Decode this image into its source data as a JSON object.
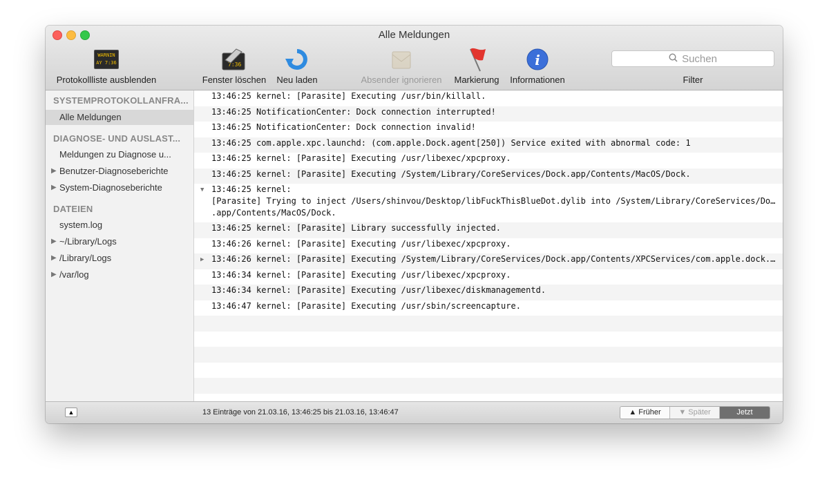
{
  "window": {
    "title": "Alle Meldungen"
  },
  "toolbar": {
    "hide_list_label": "Protokollliste ausblenden",
    "warn_icon_text": "WARNING\nAY 7:36",
    "clear_label": "Fenster löschen",
    "reload_label": "Neu laden",
    "ignore_sender_label": "Absender ignorieren",
    "mark_label": "Markierung",
    "info_label": "Informationen",
    "search_placeholder": "Suchen",
    "filter_label": "Filter"
  },
  "sidebar": {
    "section1": "SYSTEMPROTOKOLLANFRA...",
    "section1_items": [
      {
        "label": "Alle Meldungen"
      }
    ],
    "section2": "DIAGNOSE- UND AUSLAST...",
    "section2_items": [
      {
        "label": "Meldungen zu Diagnose u..."
      },
      {
        "label": "Benutzer-Diagnoseberichte"
      },
      {
        "label": "System-Diagnoseberichte"
      }
    ],
    "section3": "DATEIEN",
    "section3_items": [
      {
        "label": "system.log"
      },
      {
        "label": "~/Library/Logs"
      },
      {
        "label": "/Library/Logs"
      },
      {
        "label": "/var/log"
      }
    ]
  },
  "log": [
    {
      "text": "13:46:25 kernel: [Parasite] Executing /usr/bin/killall."
    },
    {
      "text": "13:46:25 NotificationCenter: Dock connection interrupted!"
    },
    {
      "text": "13:46:25 NotificationCenter: Dock connection invalid!"
    },
    {
      "text": "13:46:25 com.apple.xpc.launchd: (com.apple.Dock.agent[250]) Service exited with abnormal code: 1"
    },
    {
      "text": "13:46:25 kernel: [Parasite] Executing /usr/libexec/xpcproxy."
    },
    {
      "text": "13:46:25 kernel: [Parasite] Executing /System/Library/CoreServices/Dock.app/Contents/MacOS/Dock."
    },
    {
      "text": "13:46:25 kernel:",
      "line2": "[Parasite] Trying to inject /Users/shinvou/Desktop/libFuckThisBlueDot.dylib into /System/Library/CoreServices/Dock",
      "line3": ".app/Contents/MacOS/Dock."
    },
    {
      "text": "13:46:25 kernel: [Parasite] Library successfully injected."
    },
    {
      "text": "13:46:26 kernel: [Parasite] Executing /usr/libexec/xpcproxy."
    },
    {
      "text": "13:46:26 kernel: [Parasite] Executing /System/Library/CoreServices/Dock.app/Contents/XPCServices/com.apple.dock.e…"
    },
    {
      "text": "13:46:34 kernel: [Parasite] Executing /usr/libexec/xpcproxy."
    },
    {
      "text": "13:46:34 kernel: [Parasite] Executing /usr/libexec/diskmanagementd."
    },
    {
      "text": "13:46:47 kernel: [Parasite] Executing /usr/sbin/screencapture."
    }
  ],
  "status": {
    "summary": "13 Einträge von 21.03.16, 13:46:25 bis 21.03.16, 13:46:47",
    "earlier": "Früher",
    "later": "Später",
    "now": "Jetzt"
  }
}
